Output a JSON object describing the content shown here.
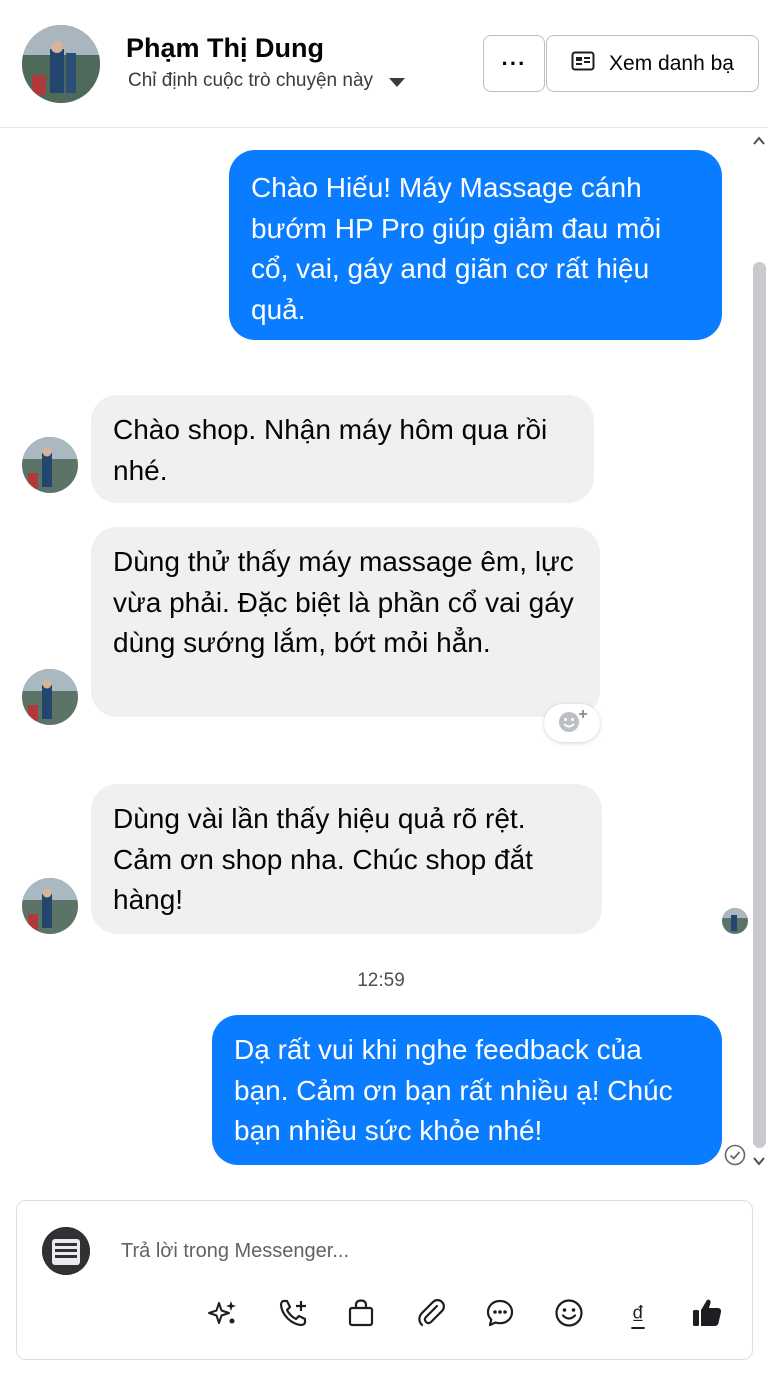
{
  "header": {
    "contact_name": "Phạm Thị Dung",
    "assign_label": "Chỉ định cuộc trò chuyện này",
    "more_label": "···",
    "view_contact_label": "Xem danh bạ"
  },
  "messages": [
    {
      "direction": "outgoing",
      "text": "Chào Hiếu! Máy Massage cánh bướm HP Pro giúp giảm đau mỏi cổ, vai, gáy and giãn cơ rất hiệu quả."
    },
    {
      "direction": "incoming",
      "text": "Chào shop. Nhận máy hôm qua rồi nhé."
    },
    {
      "direction": "incoming",
      "text": "Dùng thử thấy máy massage êm, lực vừa phải. Đặc biệt là phần cổ vai gáy dùng sướng lắm, bớt mỏi hẳn."
    },
    {
      "direction": "incoming",
      "text": "Dùng vài lần thấy hiệu quả rõ rệt. Cảm ơn shop nha. Chúc shop đắt hàng!"
    },
    {
      "direction": "outgoing",
      "text": "Dạ rất vui khi nghe feedback của bạn. Cảm ơn bạn rất nhiều ạ! Chúc bạn nhiều sức khỏe nhé!"
    }
  ],
  "timestamp": "12:59",
  "composer": {
    "placeholder": "Trả lời trong Messenger...",
    "currency_symbol": "₫"
  },
  "icons": [
    "more-icon",
    "contact-card-icon",
    "emoji-react-icon",
    "sparkle-icon",
    "call-add-icon",
    "shopping-bag-icon",
    "attachment-icon",
    "chat-bubble-icon",
    "emoji-icon",
    "currency-icon",
    "thumbs-up-icon",
    "read-check-icon"
  ],
  "colors": {
    "outgoing_bubble": "#0a7cff",
    "incoming_bubble": "#f0f0f0",
    "text": "#050505"
  }
}
